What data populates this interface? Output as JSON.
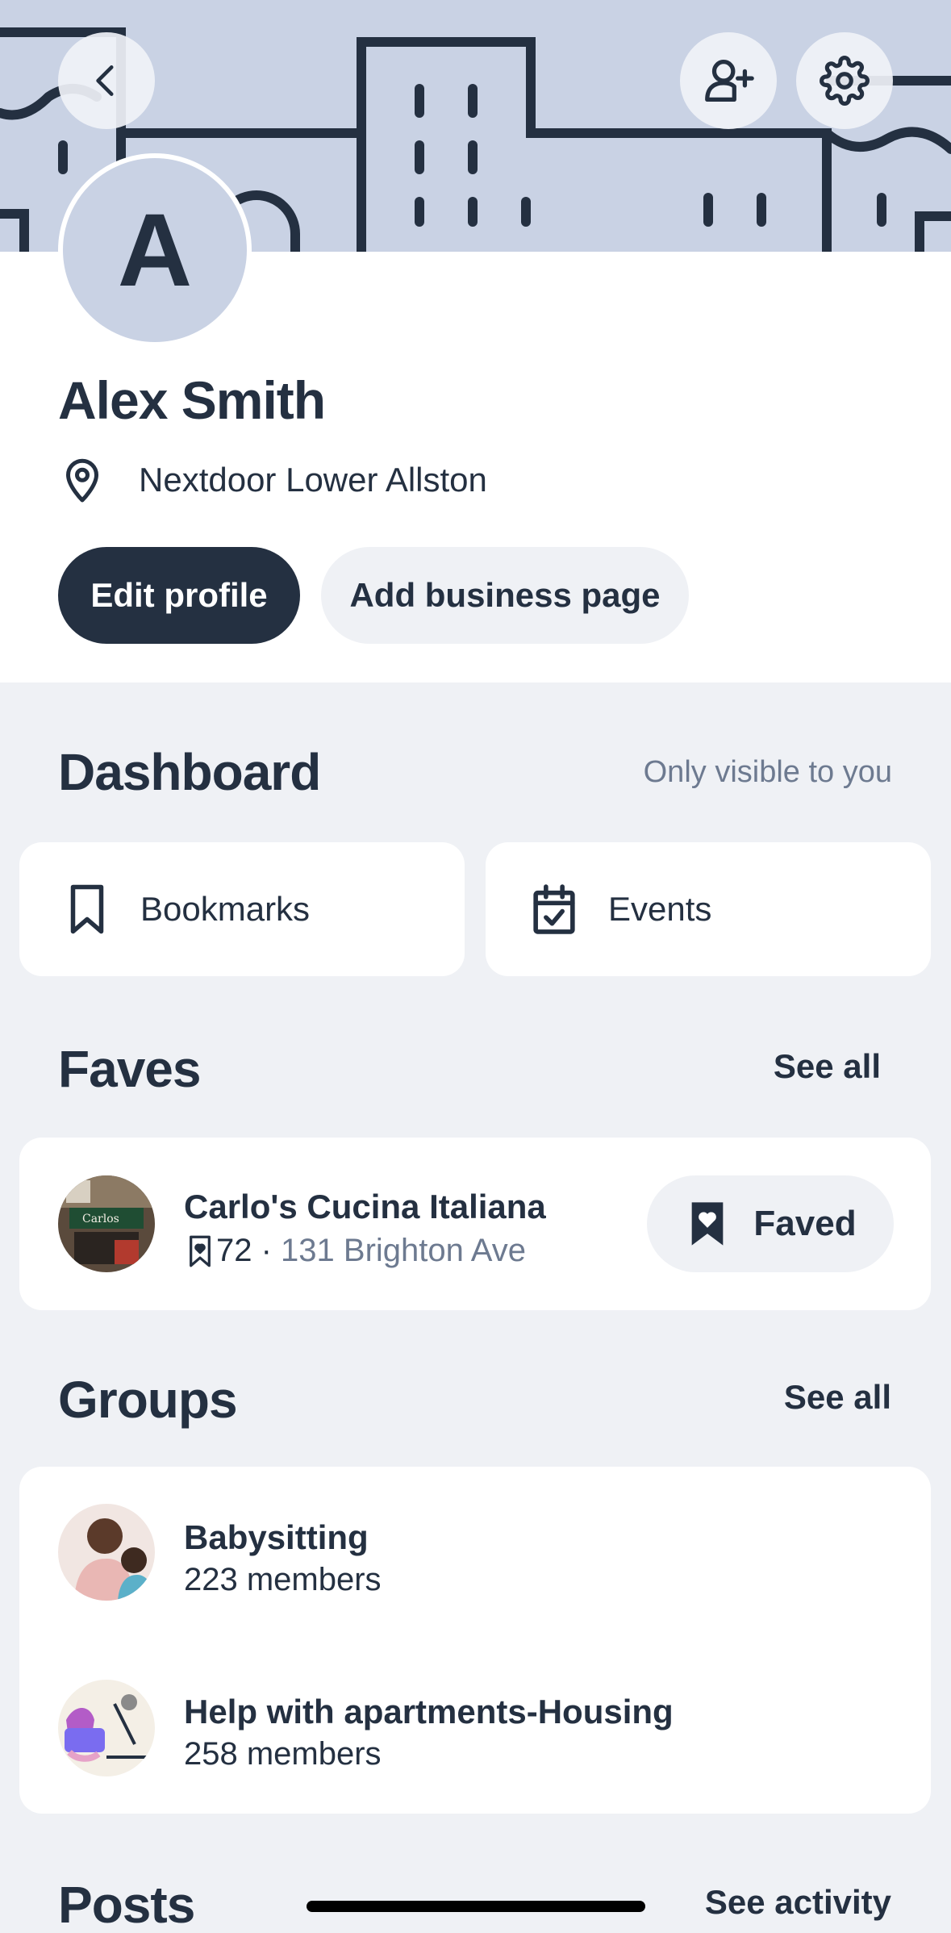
{
  "colors": {
    "navy": "#243041",
    "header_bg": "#c9d2e4",
    "page_bg": "#eff1f5",
    "muted": "#6d7a90"
  },
  "header": {
    "icons": [
      "chevron-left-icon",
      "add-user-icon",
      "gear-icon"
    ]
  },
  "profile": {
    "avatar_initial": "A",
    "name": "Alex Smith",
    "location": "Nextdoor Lower Allston",
    "edit_label": "Edit profile",
    "add_business_label": "Add business page"
  },
  "dashboard": {
    "title": "Dashboard",
    "visibility_note": "Only visible to you",
    "bookmarks_label": "Bookmarks",
    "events_label": "Events"
  },
  "faves": {
    "title": "Faves",
    "see_all": "See all",
    "item": {
      "name": "Carlo's Cucina Italiana",
      "count": "72",
      "separator": " · ",
      "address": "131 Brighton Ave",
      "faved_label": "Faved"
    }
  },
  "groups": {
    "title": "Groups",
    "see_all": "See all",
    "items": [
      {
        "name": "Babysitting",
        "members": "223 members"
      },
      {
        "name": "Help with apartments-Housing",
        "members": "258 members"
      }
    ]
  },
  "posts": {
    "title": "Posts",
    "see_activity": "See activity"
  }
}
